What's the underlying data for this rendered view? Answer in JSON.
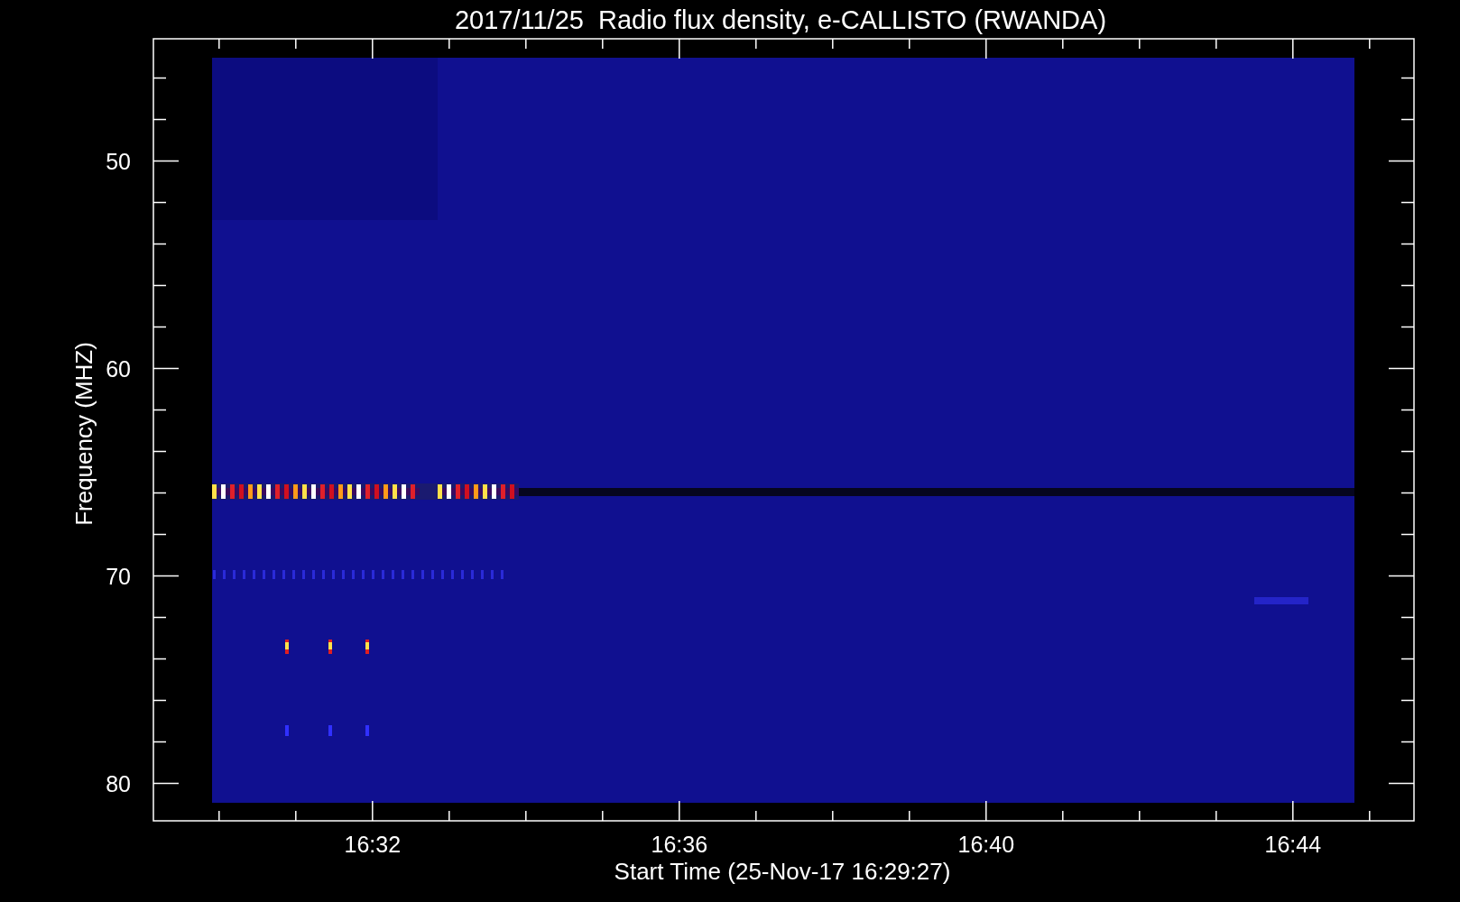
{
  "title": "2017/11/25  Radio flux density, e-CALLISTO (RWANDA)",
  "plot": {
    "xlabel": "Start Time (25-Nov-17 16:29:27)",
    "ylabel": "Frequency (MHZ)",
    "xticks": [
      {
        "label": "16:32"
      },
      {
        "label": "16:36"
      },
      {
        "label": "16:40"
      },
      {
        "label": "16:44"
      }
    ],
    "yticks": [
      {
        "label": "50"
      },
      {
        "label": "60"
      },
      {
        "label": "70"
      },
      {
        "label": "80"
      }
    ]
  }
}
